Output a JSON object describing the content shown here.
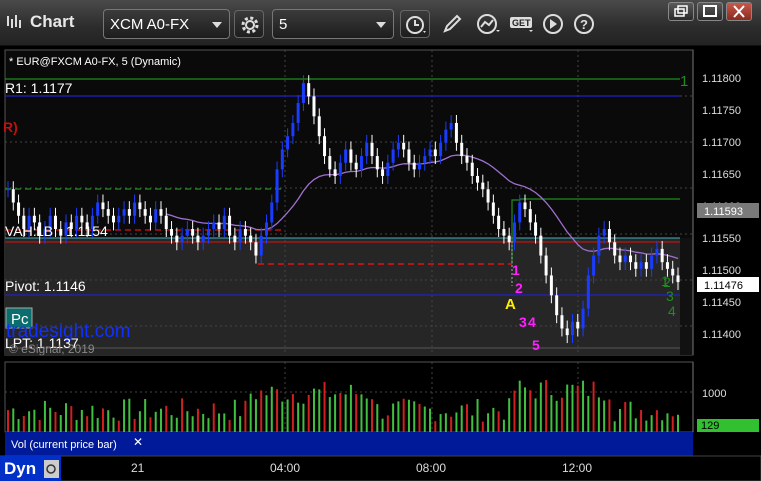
{
  "window": {
    "title": "Chart",
    "symbol": "XCM A0-FX",
    "interval": "5",
    "icons": [
      "chart-app-icon",
      "settings-gear-icon",
      "clock-icon",
      "pencil-icon",
      "studies-icon",
      "get-data-icon",
      "play-icon",
      "help-icon",
      "restore-icon",
      "maximize-icon",
      "close-icon"
    ]
  },
  "chart": {
    "header": "* EUR@FXCM A0-FX, 5 (Dynamic)",
    "price_axis_labels": [
      "1.11800",
      "1.11750",
      "1.11700",
      "1.11650",
      "1.11600",
      "1.11550",
      "1.11500",
      "1.11450",
      "1.11400"
    ],
    "price_highlights": [
      {
        "value": "1.11593",
        "bg": "#7a7a7a"
      },
      {
        "value": "1.11476",
        "bg": "#ffffff"
      }
    ],
    "level_labels": {
      "r1": "R1: 1.1177",
      "r_marker": "R)",
      "vah": "VAH:",
      "vah_suffix": "1.1154",
      "vah_overlap": "LB",
      "pivot": "Pivot: 1.1146",
      "lpt": "LPT: 1.1137"
    },
    "watermark": "tradesight.com",
    "copyright": "© eSignal, 2019",
    "pc_button": "Pc",
    "marker_A": "A",
    "seq_magenta": [
      "1",
      "2",
      "3",
      "4",
      "5"
    ],
    "seq_green_right": [
      "1",
      "2",
      "3",
      "4"
    ],
    "seq_green_top": "1",
    "colors": {
      "bull": "#1a3cff",
      "bear": "#ffffff",
      "green_line": "#1f8c1f",
      "red_dash": "#e01010",
      "blue_line": "#2020c8",
      "vwap": "#a070d0",
      "magenta": "#ff20ff"
    }
  },
  "volume": {
    "label": "Vol (current price bar)",
    "axis_label": "1000",
    "current_value": "129"
  },
  "time_axis": {
    "left_label": "Dyn",
    "labels": [
      "21",
      "04:00",
      "08:00",
      "12:00"
    ]
  },
  "chart_data": {
    "type": "candlestick",
    "title": "* EUR@FXCM A0-FX, 5 (Dynamic)",
    "ylim": [
      1.1137,
      1.1183
    ],
    "x_ticks": [
      "21",
      "04:00",
      "08:00",
      "12:00"
    ],
    "y_ticks": [
      1.118,
      1.1175,
      1.117,
      1.1165,
      1.116,
      1.1155,
      1.115,
      1.1145,
      1.114
    ],
    "levels": {
      "R1": 1.1177,
      "VAH": 1.1154,
      "Pivot": 1.1146,
      "LPT": 1.1137
    },
    "last_price": 1.11476,
    "volume_axis": [
      1000
    ],
    "current_volume": 129,
    "close_path": [
      1.1162,
      1.116,
      1.1158,
      1.1156,
      1.1158,
      1.1157,
      1.1155,
      1.1156,
      1.1158,
      1.1156,
      1.1155,
      1.1157,
      1.1156,
      1.1158,
      1.1157,
      1.1156,
      1.1158,
      1.116,
      1.1159,
      1.1158,
      1.1157,
      1.1158,
      1.1159,
      1.1158,
      1.116,
      1.1159,
      1.1158,
      1.1157,
      1.1159,
      1.1158,
      1.1156,
      1.1155,
      1.1154,
      1.1155,
      1.1156,
      1.1155,
      1.1154,
      1.1155,
      1.1156,
      1.1157,
      1.1156,
      1.1158,
      1.1155,
      1.1154,
      1.1156,
      1.1155,
      1.1154,
      1.1152,
      1.1155,
      1.1157,
      1.116,
      1.1165,
      1.1168,
      1.117,
      1.1172,
      1.1175,
      1.1178,
      1.1176,
      1.1173,
      1.117,
      1.1167,
      1.1165,
      1.1164,
      1.1166,
      1.1168,
      1.1166,
      1.1165,
      1.1167,
      1.1169,
      1.1167,
      1.1165,
      1.1164,
      1.1166,
      1.1168,
      1.1169,
      1.1168,
      1.1166,
      1.1165,
      1.1166,
      1.1167,
      1.1168,
      1.1167,
      1.1169,
      1.1171,
      1.1172,
      1.1169,
      1.1167,
      1.1166,
      1.1164,
      1.1163,
      1.1162,
      1.116,
      1.1158,
      1.1156,
      1.1155,
      1.1154,
      1.1157,
      1.116,
      1.1159,
      1.1157,
      1.1155,
      1.1152,
      1.1149,
      1.1146,
      1.1143,
      1.1141,
      1.114,
      1.1142,
      1.1141,
      1.1144,
      1.1149,
      1.1152,
      1.1155,
      1.1156,
      1.1154,
      1.1152,
      1.1151,
      1.1152,
      1.1151,
      1.115,
      1.1151,
      1.115,
      1.1152,
      1.1153,
      1.1151,
      1.115,
      1.1149,
      1.1148
    ]
  }
}
